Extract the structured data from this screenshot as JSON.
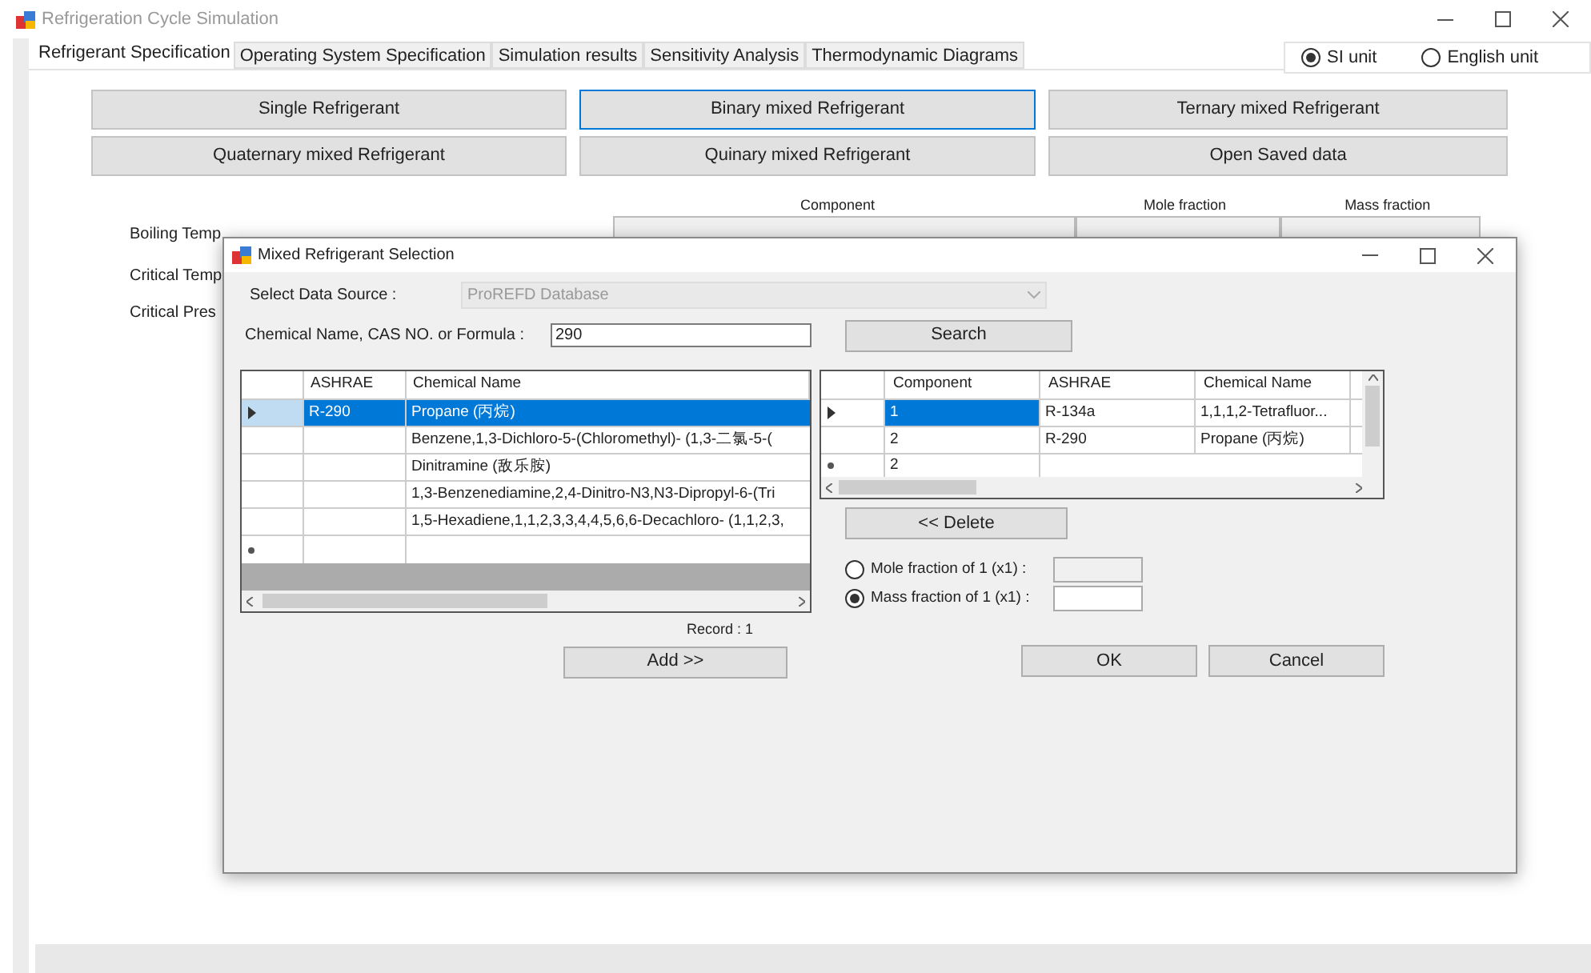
{
  "window": {
    "title": "Refrigeration Cycle Simulation"
  },
  "tabs": [
    {
      "label": "Refrigerant Specification",
      "selected": true
    },
    {
      "label": "Operating System Specification",
      "selected": false
    },
    {
      "label": "Simulation results",
      "selected": false
    },
    {
      "label": "Sensitivity Analysis",
      "selected": false
    },
    {
      "label": "Thermodynamic Diagrams",
      "selected": false
    }
  ],
  "units": [
    {
      "label": "SI unit",
      "selected": true
    },
    {
      "label": "English unit",
      "selected": false
    }
  ],
  "refrigerant_buttons": [
    {
      "label": "Single Refrigerant",
      "focused": false
    },
    {
      "label": "Binary mixed Refrigerant",
      "focused": true
    },
    {
      "label": "Ternary mixed Refrigerant",
      "focused": false
    },
    {
      "label": "Quaternary mixed Refrigerant",
      "focused": false
    },
    {
      "label": "Quinary mixed Refrigerant",
      "focused": false
    },
    {
      "label": "Open Saved data",
      "focused": false
    }
  ],
  "composition_headers": [
    "Component",
    "Mole fraction",
    "Mass fraction"
  ],
  "property_labels": [
    "Boiling Temp",
    "Critical Temp",
    "Critical Pres"
  ],
  "dialog": {
    "title": "Mixed Refrigerant Selection",
    "data_source_label": "Select Data Source :",
    "data_source_value": "ProREFD Database",
    "data_source_disabled": true,
    "search_label": "Chemical Name, CAS NO. or Formula :",
    "search_value": "290",
    "search_button": "Search",
    "search_grid": {
      "columns": [
        "ASHRAE",
        "Chemical Name"
      ],
      "rows": [
        {
          "ashrae": "R-290",
          "name": "Propane (丙烷)",
          "selected": true
        },
        {
          "ashrae": "",
          "name": "Benzene,1,3-Dichloro-5-(Chloromethyl)- (1,3-二氯-5-(",
          "selected": false
        },
        {
          "ashrae": "",
          "name": "Dinitramine (敌乐胺)",
          "selected": false
        },
        {
          "ashrae": "",
          "name": "1,3-Benzenediamine,2,4-Dinitro-N3,N3-Dipropyl-6-(Tri",
          "selected": false
        },
        {
          "ashrae": "",
          "name": "1,5-Hexadiene,1,1,2,3,3,4,4,5,6,6-Decachloro- (1,1,2,3,",
          "selected": false
        }
      ]
    },
    "record": "Record : 1",
    "add_button": "Add >>",
    "components_grid": {
      "columns": [
        "Component",
        "ASHRAE",
        "Chemical Name"
      ],
      "rows": [
        {
          "component": "1",
          "ashrae": "R-134a",
          "name": "1,1,1,2-Tetrafluor...",
          "selected": true
        },
        {
          "component": "2",
          "ashrae": "R-290",
          "name": "Propane (丙烷)",
          "selected": false
        }
      ],
      "new_row_component": "2"
    },
    "delete_button": "<< Delete",
    "fraction_options": [
      {
        "label": "Mole fraction of 1 (x1) :",
        "selected": false
      },
      {
        "label": "Mass fraction of 1 (x1) :",
        "selected": true
      }
    ],
    "ok_button": "OK",
    "cancel_button": "Cancel"
  }
}
